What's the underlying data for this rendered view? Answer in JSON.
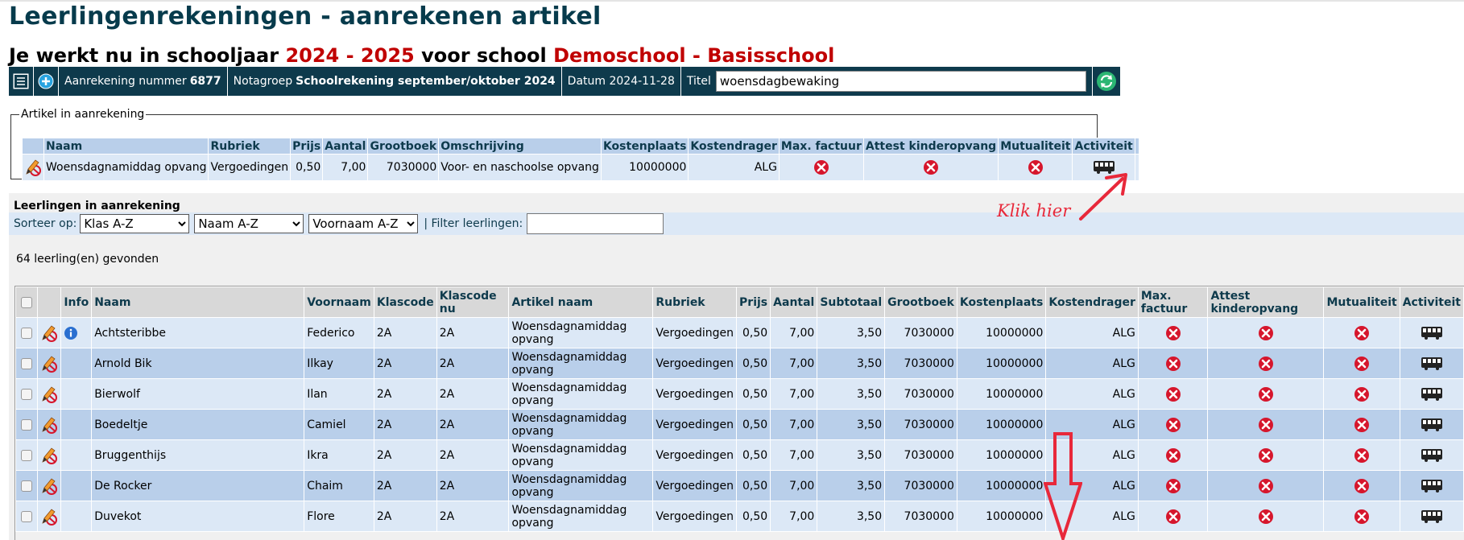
{
  "page": {
    "title": "Leerlingenrekeningen - aanrekenen artikel",
    "subtitle_prefix": "Je werkt nu in schooljaar",
    "schooljaar": "2024 - 2025",
    "subtitle_mid": "voor school",
    "school": "Demoschool - Basisschool"
  },
  "infobar": {
    "aanrekening_label": "Aanrekening nummer",
    "aanrekening_nummer": "6877",
    "notagroep_label": "Notagroep",
    "notagroep_value": "Schoolrekening september/oktober 2024",
    "datum_label": "Datum",
    "datum_value": "2024-11-28",
    "titel_label": "Titel",
    "titel_value": "woensdagbewaking"
  },
  "artikel": {
    "legend": "Artikel in aanrekening",
    "headers": [
      "Naam",
      "Rubriek",
      "Prijs",
      "Aantal",
      "Grootboek",
      "Omschrijving",
      "Kostenplaats",
      "Kostendrager",
      "Max. factuur",
      "Attest kinderopvang",
      "Mutualiteit",
      "Activiteit"
    ],
    "row": {
      "naam": "Woensdagnamiddag opvang",
      "rubriek": "Vergoedingen",
      "prijs": "0,50",
      "aantal": "7,00",
      "grootboek": "7030000",
      "omschrijving": "Voor- en naschoolse opvang",
      "kostenplaats": "10000000",
      "kostendrager": "ALG"
    }
  },
  "leerlingen": {
    "section_title": "Leerlingen in aanrekening",
    "sort_label": "Sorteer op:",
    "sort_klas": "Klas A-Z",
    "sort_naam": "Naam A-Z",
    "sort_voornaam": "Voornaam A-Z",
    "filter_label": "| Filter leerlingen:",
    "found_text": "64 leerling(en) gevonden",
    "headers": {
      "info": "Info",
      "naam": "Naam",
      "voornaam": "Voornaam",
      "klascode": "Klascode",
      "klascode_nu": "Klascode nu",
      "artikel_naam": "Artikel naam",
      "rubriek": "Rubriek",
      "prijs": "Prijs",
      "aantal": "Aantal",
      "subtotaal": "Subtotaal",
      "grootboek": "Grootboek",
      "kostenplaats": "Kostenplaats",
      "kostendrager": "Kostendrager",
      "max_factuur": "Max. factuur",
      "attest": "Attest kinderopvang",
      "mutualiteit": "Mutualiteit",
      "activiteit": "Activiteit"
    },
    "rows": [
      {
        "naam": "Achtsteribbe",
        "voornaam": "Federico",
        "klas": "2A",
        "klas_nu": "2A",
        "artikel": "Woensdagnamiddag opvang",
        "rubriek": "Vergoedingen",
        "prijs": "0,50",
        "aantal": "7,00",
        "subtotaal": "3,50",
        "grootboek": "7030000",
        "kostenplaats": "10000000",
        "kostendrager": "ALG",
        "info": true
      },
      {
        "naam": "Arnold Bik",
        "voornaam": "Ilkay",
        "klas": "2A",
        "klas_nu": "2A",
        "artikel": "Woensdagnamiddag opvang",
        "rubriek": "Vergoedingen",
        "prijs": "0,50",
        "aantal": "7,00",
        "subtotaal": "3,50",
        "grootboek": "7030000",
        "kostenplaats": "10000000",
        "kostendrager": "ALG",
        "info": false
      },
      {
        "naam": "Bierwolf",
        "voornaam": "Ilan",
        "klas": "2A",
        "klas_nu": "2A",
        "artikel": "Woensdagnamiddag opvang",
        "rubriek": "Vergoedingen",
        "prijs": "0,50",
        "aantal": "7,00",
        "subtotaal": "3,50",
        "grootboek": "7030000",
        "kostenplaats": "10000000",
        "kostendrager": "ALG",
        "info": false
      },
      {
        "naam": "Boedeltje",
        "voornaam": "Camiel",
        "klas": "2A",
        "klas_nu": "2A",
        "artikel": "Woensdagnamiddag opvang",
        "rubriek": "Vergoedingen",
        "prijs": "0,50",
        "aantal": "7,00",
        "subtotaal": "3,50",
        "grootboek": "7030000",
        "kostenplaats": "10000000",
        "kostendrager": "ALG",
        "info": false
      },
      {
        "naam": "Bruggenthijs",
        "voornaam": "Ikra",
        "klas": "2A",
        "klas_nu": "2A",
        "artikel": "Woensdagnamiddag opvang",
        "rubriek": "Vergoedingen",
        "prijs": "0,50",
        "aantal": "7,00",
        "subtotaal": "3,50",
        "grootboek": "7030000",
        "kostenplaats": "10000000",
        "kostendrager": "ALG",
        "info": false
      },
      {
        "naam": "De Rocker",
        "voornaam": "Chaim",
        "klas": "2A",
        "klas_nu": "2A",
        "artikel": "Woensdagnamiddag opvang",
        "rubriek": "Vergoedingen",
        "prijs": "0,50",
        "aantal": "7,00",
        "subtotaal": "3,50",
        "grootboek": "7030000",
        "kostenplaats": "10000000",
        "kostendrager": "ALG",
        "info": false
      },
      {
        "naam": "Duvekot",
        "voornaam": "Flore",
        "klas": "2A",
        "klas_nu": "2A",
        "artikel": "Woensdagnamiddag opvang",
        "rubriek": "Vergoedingen",
        "prijs": "0,50",
        "aantal": "7,00",
        "subtotaal": "3,50",
        "grootboek": "7030000",
        "kostenplaats": "10000000",
        "kostendrager": "ALG",
        "info": false
      }
    ]
  },
  "annotation": {
    "text": "Klik hier",
    "color": "#e8283a"
  },
  "colors": {
    "title": "#073b4c",
    "accent_red": "#c00000",
    "bar": "#0e3a4c",
    "icon_red": "#d6162c"
  }
}
